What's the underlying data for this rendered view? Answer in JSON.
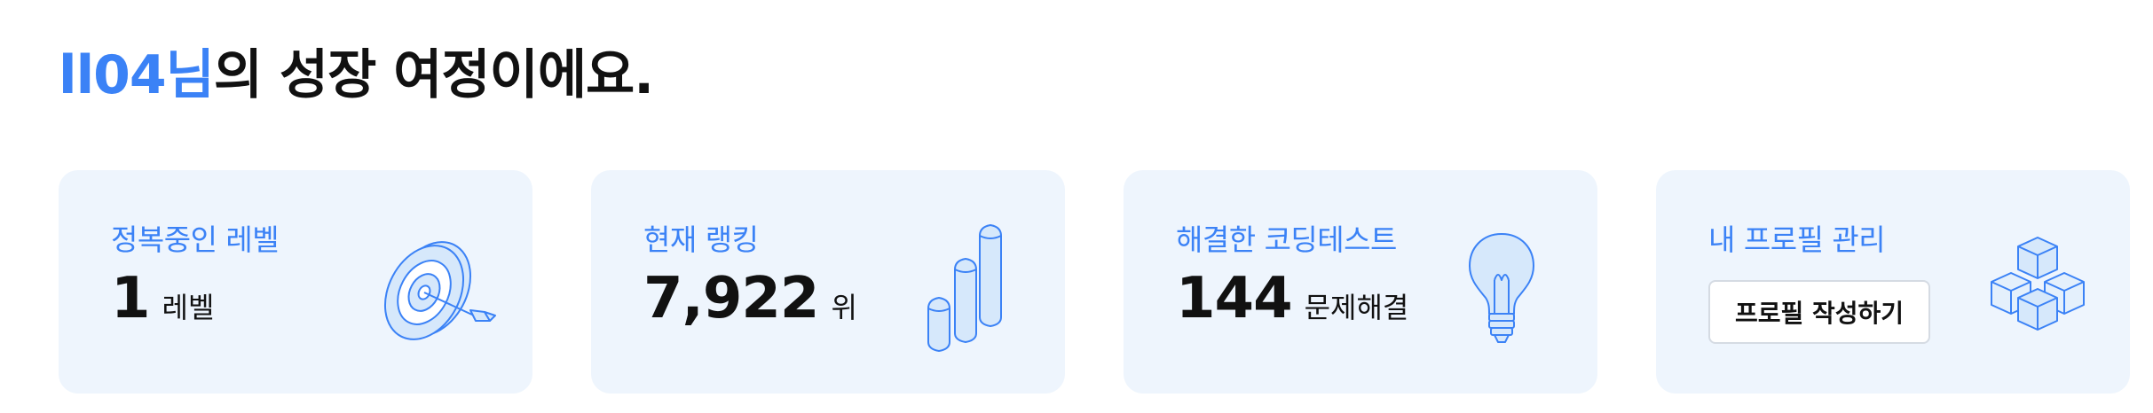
{
  "header": {
    "username": "ll04님",
    "title_suffix": "의 성장 여정이에요."
  },
  "cards": {
    "level": {
      "label": "정복중인 레벨",
      "value": "1",
      "unit": "레벨",
      "icon": "target-icon"
    },
    "ranking": {
      "label": "현재 랭킹",
      "value": "7,922",
      "unit": "위",
      "icon": "bar-chart-icon"
    },
    "solved": {
      "label": "해결한 코딩테스트",
      "value": "144",
      "unit": "문제해결",
      "icon": "lightbulb-icon"
    },
    "profile": {
      "label": "내 프로필 관리",
      "button_label": "프로필 작성하기",
      "icon": "cubes-icon"
    }
  },
  "colors": {
    "accent": "#3b82f6",
    "card_bg": "#eef5fd",
    "icon_fill": "#d6e8fb",
    "icon_stroke": "#3b82f6"
  }
}
